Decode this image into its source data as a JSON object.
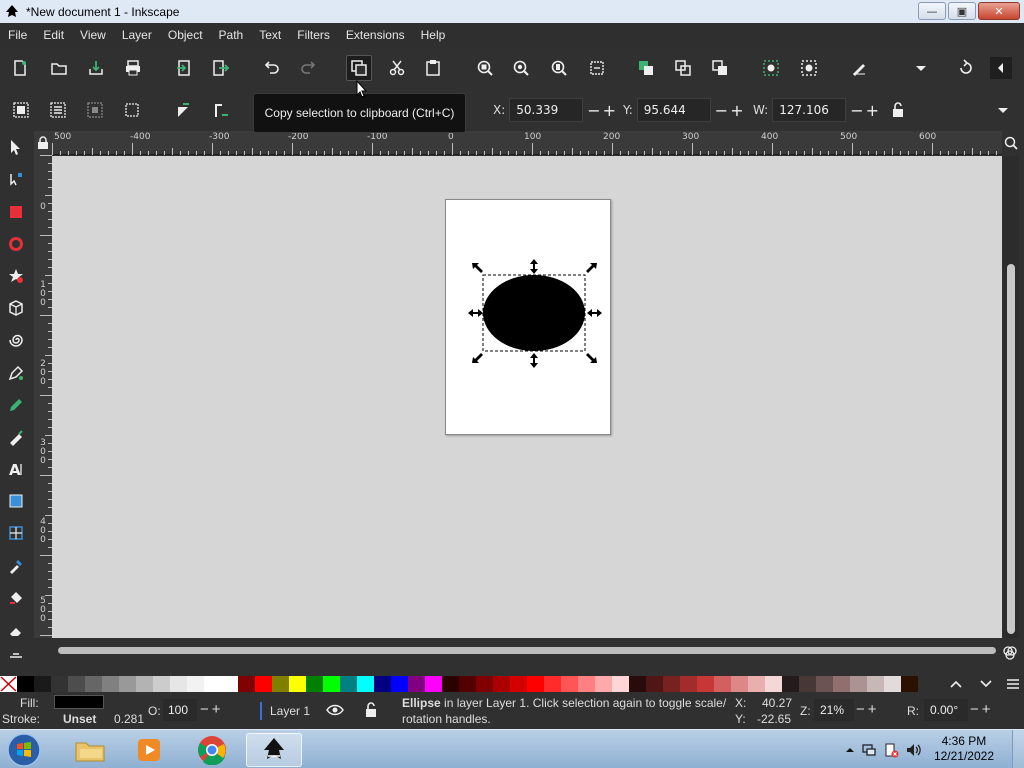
{
  "window": {
    "title": "*New document 1 - Inkscape",
    "minimize": "—",
    "maximize": "▣",
    "close": "✕"
  },
  "menu": [
    "File",
    "Edit",
    "View",
    "Layer",
    "Object",
    "Path",
    "Text",
    "Filters",
    "Extensions",
    "Help"
  ],
  "tooltip": "Copy selection to clipboard (Ctrl+C)",
  "controls": {
    "x": {
      "label": "X:",
      "value": "50.339"
    },
    "y": {
      "label": "Y:",
      "value": "95.644"
    },
    "w": {
      "label": "W:",
      "value": "127.106"
    },
    "pm": "−+"
  },
  "hruler_labels": [
    "500",
    "-400",
    "-300",
    "-200",
    "-100",
    "0",
    "100",
    "200",
    "300",
    "400",
    "500",
    "600"
  ],
  "vruler_labels": [
    [
      "0"
    ],
    [
      "1",
      "0",
      "0"
    ],
    [
      "2",
      "0",
      "0"
    ],
    [
      "3",
      "0",
      "0"
    ],
    [
      "4",
      "0",
      "0"
    ],
    [
      "5",
      "0",
      "0"
    ]
  ],
  "palette": [
    "#000000",
    "#1a1a1a",
    "#333333",
    "#4d4d4d",
    "#666666",
    "#808080",
    "#999999",
    "#b3b3b3",
    "#cccccc",
    "#e6e6e6",
    "#f2f2f2",
    "#ffffff",
    "#ffffff",
    "#800000",
    "#ff0000",
    "#808000",
    "#ffff00",
    "#008000",
    "#00ff00",
    "#008080",
    "#00ffff",
    "#000080",
    "#0000ff",
    "#800080",
    "#ff00ff",
    "#2b0000",
    "#550000",
    "#800000",
    "#aa0000",
    "#d40000",
    "#ff0000",
    "#ff2a2a",
    "#ff5555",
    "#ff8080",
    "#ffaaaa",
    "#ffd5d5",
    "#280b0b",
    "#501616",
    "#782121",
    "#a02c2c",
    "#c83737",
    "#d35f5f",
    "#de8787",
    "#e9afaf",
    "#f4d7d7",
    "#241c1c",
    "#483737",
    "#6c5353",
    "#916f6f",
    "#ac9393",
    "#c8b7b7",
    "#e3dbdb",
    "#2b1100"
  ],
  "status": {
    "fill_label": "Fill:",
    "stroke_label": "Stroke:",
    "stroke_value": "Unset",
    "stroke_width": "0.281",
    "opacity_label": "O:",
    "opacity_value": "100",
    "layer": "Layer 1",
    "message_bold": "Ellipse",
    "message_rest": " in layer Layer 1. Click selection again to toggle scale/",
    "message_line2": "rotation handles.",
    "cursor_x_label": "X:",
    "cursor_x": "40.27",
    "cursor_y_label": "Y:",
    "cursor_y": "-22.65",
    "zoom_label": "Z:",
    "zoom": "21%",
    "rotate_label": "R:",
    "rotate": "0.00°"
  },
  "clock": {
    "time": "4:36 PM",
    "date": "12/21/2022"
  },
  "colors": {
    "accent_green": "#3cb371",
    "tool_red": "#e8303a",
    "palette_bg": "#303030"
  }
}
